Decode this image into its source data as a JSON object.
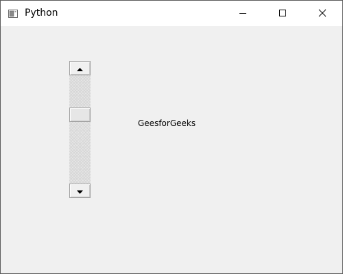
{
  "window": {
    "title": "Python",
    "icons": {
      "app": "python-app-icon",
      "minimize": "minimize-icon",
      "maximize": "maximize-icon",
      "close": "close-icon"
    }
  },
  "scrollbar": {
    "orientation": "vertical",
    "up_arrow": "arrow-up-icon",
    "down_arrow": "arrow-down-icon",
    "position_fraction": 0.35
  },
  "label": {
    "text": "GeesforGeeks"
  }
}
